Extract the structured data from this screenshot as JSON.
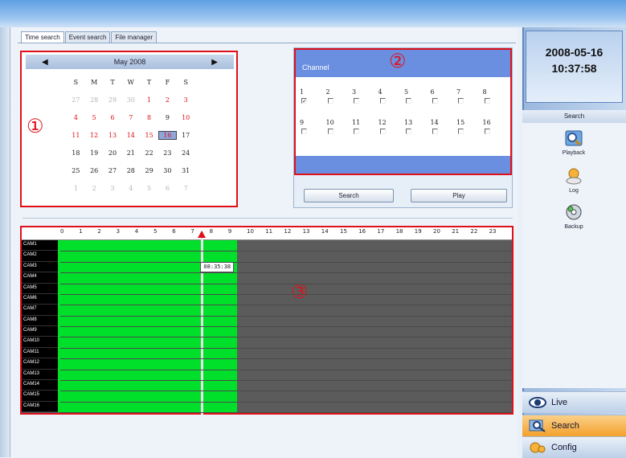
{
  "tabs": [
    {
      "label": "Time search"
    },
    {
      "label": "Event search"
    },
    {
      "label": "File manager"
    }
  ],
  "calendar": {
    "month_label": "May 2008",
    "weekdays": [
      "S",
      "M",
      "T",
      "W",
      "T",
      "F",
      "S"
    ],
    "weeks": [
      [
        {
          "d": "27",
          "c": "gray"
        },
        {
          "d": "28",
          "c": "gray"
        },
        {
          "d": "29",
          "c": "gray"
        },
        {
          "d": "30",
          "c": "gray"
        },
        {
          "d": "1",
          "c": "red"
        },
        {
          "d": "2",
          "c": "red"
        },
        {
          "d": "3",
          "c": "red"
        }
      ],
      [
        {
          "d": "4",
          "c": "red"
        },
        {
          "d": "5",
          "c": "red"
        },
        {
          "d": "6",
          "c": "red"
        },
        {
          "d": "7",
          "c": "red"
        },
        {
          "d": "8",
          "c": "red"
        },
        {
          "d": "9",
          "c": "blk"
        },
        {
          "d": "10",
          "c": "red"
        }
      ],
      [
        {
          "d": "11",
          "c": "red"
        },
        {
          "d": "12",
          "c": "red"
        },
        {
          "d": "13",
          "c": "red"
        },
        {
          "d": "14",
          "c": "red"
        },
        {
          "d": "15",
          "c": "red"
        },
        {
          "d": "16",
          "c": "sel"
        },
        {
          "d": "17",
          "c": "blk"
        }
      ],
      [
        {
          "d": "18",
          "c": "blk"
        },
        {
          "d": "19",
          "c": "blk"
        },
        {
          "d": "20",
          "c": "blk"
        },
        {
          "d": "21",
          "c": "blk"
        },
        {
          "d": "22",
          "c": "blk"
        },
        {
          "d": "23",
          "c": "blk"
        },
        {
          "d": "24",
          "c": "blk"
        }
      ],
      [
        {
          "d": "25",
          "c": "blk"
        },
        {
          "d": "26",
          "c": "blk"
        },
        {
          "d": "27",
          "c": "blk"
        },
        {
          "d": "28",
          "c": "blk"
        },
        {
          "d": "29",
          "c": "blk"
        },
        {
          "d": "30",
          "c": "blk"
        },
        {
          "d": "31",
          "c": "blk"
        }
      ],
      [
        {
          "d": "1",
          "c": "gray"
        },
        {
          "d": "2",
          "c": "gray"
        },
        {
          "d": "3",
          "c": "gray"
        },
        {
          "d": "4",
          "c": "gray"
        },
        {
          "d": "5",
          "c": "gray"
        },
        {
          "d": "6",
          "c": "gray"
        },
        {
          "d": "7",
          "c": "gray"
        }
      ]
    ]
  },
  "callouts": {
    "one": "①",
    "two": "②",
    "three": "③"
  },
  "channel": {
    "title": "Channel",
    "channels": [
      {
        "n": "1",
        "checked": true
      },
      {
        "n": "2",
        "checked": false
      },
      {
        "n": "3",
        "checked": false
      },
      {
        "n": "4",
        "checked": false
      },
      {
        "n": "5",
        "checked": false
      },
      {
        "n": "6",
        "checked": false
      },
      {
        "n": "7",
        "checked": false
      },
      {
        "n": "8",
        "checked": false
      },
      {
        "n": "9",
        "checked": false
      },
      {
        "n": "10",
        "checked": false
      },
      {
        "n": "11",
        "checked": false
      },
      {
        "n": "12",
        "checked": false
      },
      {
        "n": "13",
        "checked": false
      },
      {
        "n": "14",
        "checked": false
      },
      {
        "n": "15",
        "checked": false
      },
      {
        "n": "16",
        "checked": false
      }
    ],
    "check_mark": "✓"
  },
  "buttons": {
    "search": "Search",
    "play": "Play"
  },
  "timeline": {
    "hours": [
      "0",
      "1",
      "2",
      "3",
      "4",
      "5",
      "6",
      "7",
      "8",
      "9",
      "10",
      "11",
      "12",
      "13",
      "14",
      "15",
      "16",
      "17",
      "18",
      "19",
      "20",
      "21",
      "22",
      "23"
    ],
    "cameras": [
      "CAM1",
      "CAM2",
      "CAM3",
      "CAM4",
      "CAM5",
      "CAM6",
      "CAM7",
      "CAM8",
      "CAM9",
      "CAM10",
      "CAM11",
      "CAM12",
      "CAM13",
      "CAM14",
      "CAM15",
      "CAM16"
    ],
    "cursor_time": "08:35:38",
    "recorded_hours": {
      "start": 1,
      "end": 10.6
    },
    "cursor_hour": 8.59
  },
  "clock": {
    "date": "2008-05-16",
    "time": "10:37:58"
  },
  "sidebar": {
    "title": "Search",
    "items": [
      {
        "label": "Playback",
        "icon": "playback-icon"
      },
      {
        "label": "Log",
        "icon": "log-icon"
      },
      {
        "label": "Backup",
        "icon": "backup-icon"
      }
    ]
  },
  "nav": [
    {
      "label": "Live",
      "icon": "eye-icon"
    },
    {
      "label": "Search",
      "icon": "search-icon"
    },
    {
      "label": "Config",
      "icon": "config-icon"
    }
  ],
  "colors": {
    "accent": "#e0101a",
    "recorded": "#00e02a",
    "active_nav": "#f3a12c"
  }
}
